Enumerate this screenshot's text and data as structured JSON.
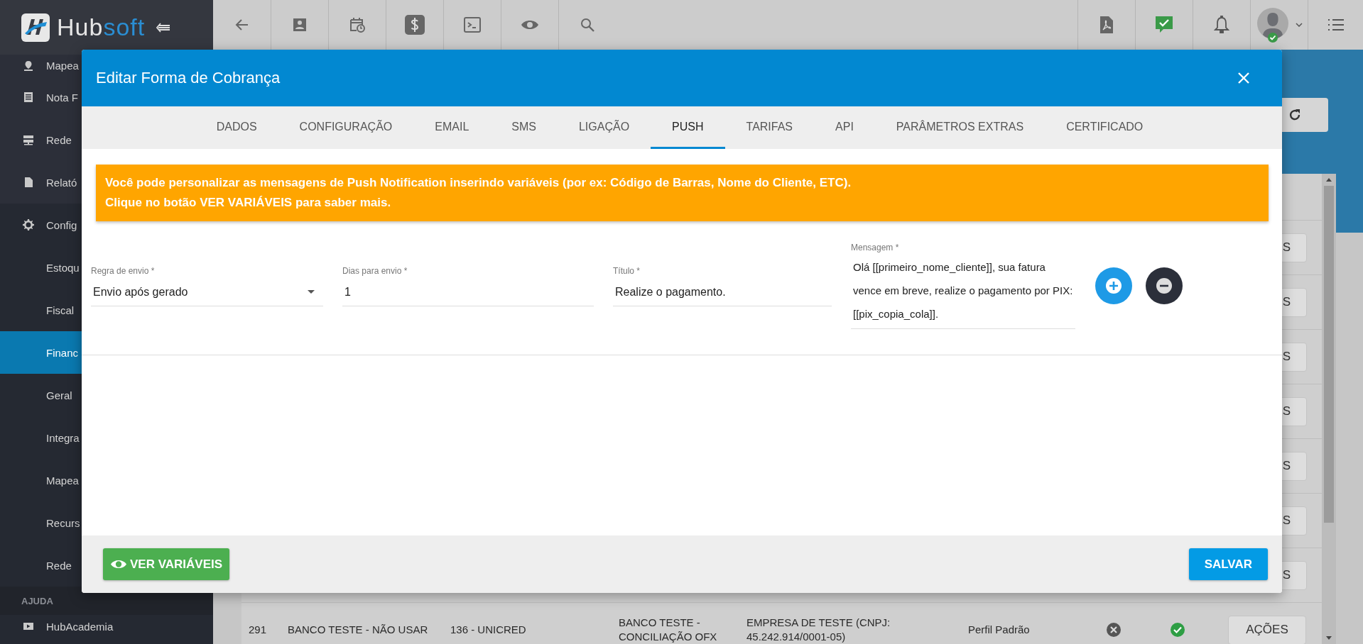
{
  "brand": {
    "parts": [
      "Hub",
      "soft"
    ]
  },
  "sidebar": {
    "items": [
      {
        "label": "Mapea",
        "kind": "main",
        "selected": false
      },
      {
        "label": "Nota F",
        "kind": "main",
        "selected": false
      },
      {
        "label": "Rede",
        "kind": "main",
        "selected": false
      },
      {
        "label": "Relató",
        "kind": "main",
        "selected": false
      },
      {
        "label": "Config",
        "kind": "main",
        "selected": false
      },
      {
        "label": "Estoqu",
        "kind": "sub",
        "selected": false
      },
      {
        "label": "Fiscal",
        "kind": "sub",
        "selected": false
      },
      {
        "label": "Financ",
        "kind": "sub",
        "selected": true
      },
      {
        "label": "Geral",
        "kind": "sub",
        "selected": false
      },
      {
        "label": "Integra",
        "kind": "sub",
        "selected": false
      },
      {
        "label": "Mapea",
        "kind": "sub",
        "selected": false
      },
      {
        "label": "Recurs",
        "kind": "sub",
        "selected": false
      },
      {
        "label": "Rede",
        "kind": "sub",
        "selected": false
      }
    ],
    "section": "AJUDA",
    "help_items": [
      {
        "label": "HubAcademia"
      }
    ]
  },
  "table": {
    "rows": [
      {
        "kind": "partial",
        "action": "S"
      },
      {
        "kind": "partial",
        "action": "S"
      },
      {
        "kind": "partial",
        "action": "S"
      },
      {
        "kind": "partial",
        "action": "S"
      },
      {
        "kind": "partial",
        "action": "S"
      },
      {
        "kind": "partial",
        "action": "S"
      },
      {
        "kind": "partial",
        "action": "S"
      },
      {
        "kind": "full",
        "id": "291",
        "name": "BANCO TESTE - NÃO USAR",
        "bank": "136 - UNICRED",
        "description": "BANCO TESTE - CONCILIAÇÃO OFX",
        "company": "EMPRESA DE TESTE (CNPJ: 45.242.914/0001-05)",
        "profile": "Perfil Padrão",
        "active": false,
        "enabled": true,
        "action": "AÇÕES"
      }
    ]
  },
  "modal": {
    "title": "Editar Forma de Cobrança",
    "tabs": [
      {
        "label": "DADOS",
        "selected": false
      },
      {
        "label": "CONFIGURAÇÃO",
        "selected": false
      },
      {
        "label": "EMAIL",
        "selected": false
      },
      {
        "label": "SMS",
        "selected": false
      },
      {
        "label": "LIGAÇÃO",
        "selected": false
      },
      {
        "label": "PUSH",
        "selected": true
      },
      {
        "label": "TARIFAS",
        "selected": false
      },
      {
        "label": "API",
        "selected": false
      },
      {
        "label": "PARÂMETROS EXTRAS",
        "selected": false
      },
      {
        "label": "CERTIFICADO",
        "selected": false
      }
    ],
    "alert": {
      "lines": [
        "Você pode personalizar as mensagens de Push Notification inserindo variáveis (por ex: Código de Barras, Nome do Cliente, ETC).",
        "Clique no botão VER VARIÁVEIS para saber mais."
      ]
    },
    "fields": [
      {
        "kind": "select",
        "label": "Regra de envio *",
        "value": "Envio após gerado"
      },
      {
        "kind": "text",
        "label": "Dias para envio *",
        "value": "1"
      },
      {
        "kind": "text",
        "label": "Título *",
        "value": "Realize o pagamento."
      },
      {
        "kind": "textarea",
        "label": "Mensagem *",
        "value": "Olá [[primeiro_nome_cliente]], sua fatura vence em breve, realize o pagamento por PIX: [[pix_copia_cola]]."
      }
    ],
    "footer": {
      "left_button": "VER VARIÁVEIS",
      "right_button": "SALVAR"
    }
  }
}
